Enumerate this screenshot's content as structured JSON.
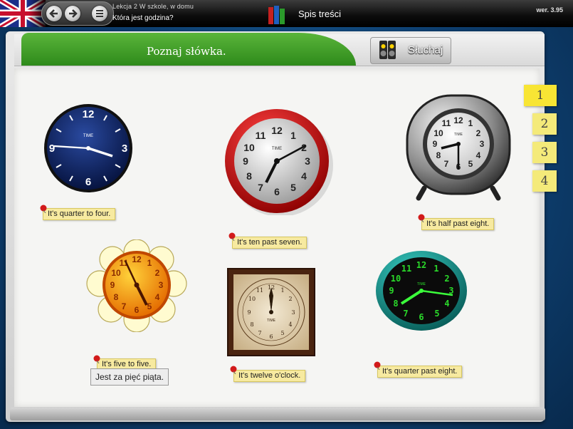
{
  "topbar": {
    "lesson_title": "Lekcja 2 W szkole, w domu",
    "lesson_subtitle": "Która jest godzina?",
    "toc_label": "Spis treści",
    "version": "wer. 3.95"
  },
  "header": {
    "title": "Poznaj słówka.",
    "listen_label": "Słuchaj"
  },
  "tabs": [
    {
      "label": "1",
      "active": true
    },
    {
      "label": "2",
      "active": false
    },
    {
      "label": "3",
      "active": false
    },
    {
      "label": "4",
      "active": false
    }
  ],
  "clocks": [
    {
      "label": "It's quarter to four."
    },
    {
      "label": "It's ten past seven."
    },
    {
      "label": "It's half past eight."
    },
    {
      "label": "It's five to five."
    },
    {
      "label": "It's twelve o'clock."
    },
    {
      "label": "It's quarter past eight."
    }
  ],
  "tooltip": "Jest za pięć piąta.",
  "clock_face_text": "TIME",
  "clock_numerals": {
    "c1": [
      "12",
      "3",
      "6",
      "9"
    ],
    "arabic": [
      "12",
      "1",
      "2",
      "3",
      "4",
      "5",
      "6",
      "7",
      "8",
      "9",
      "10",
      "11"
    ]
  },
  "colors": {
    "accent_green": "#3aa023",
    "tab_yellow": "#f8e534",
    "label_yellow": "#f7eaa0"
  }
}
